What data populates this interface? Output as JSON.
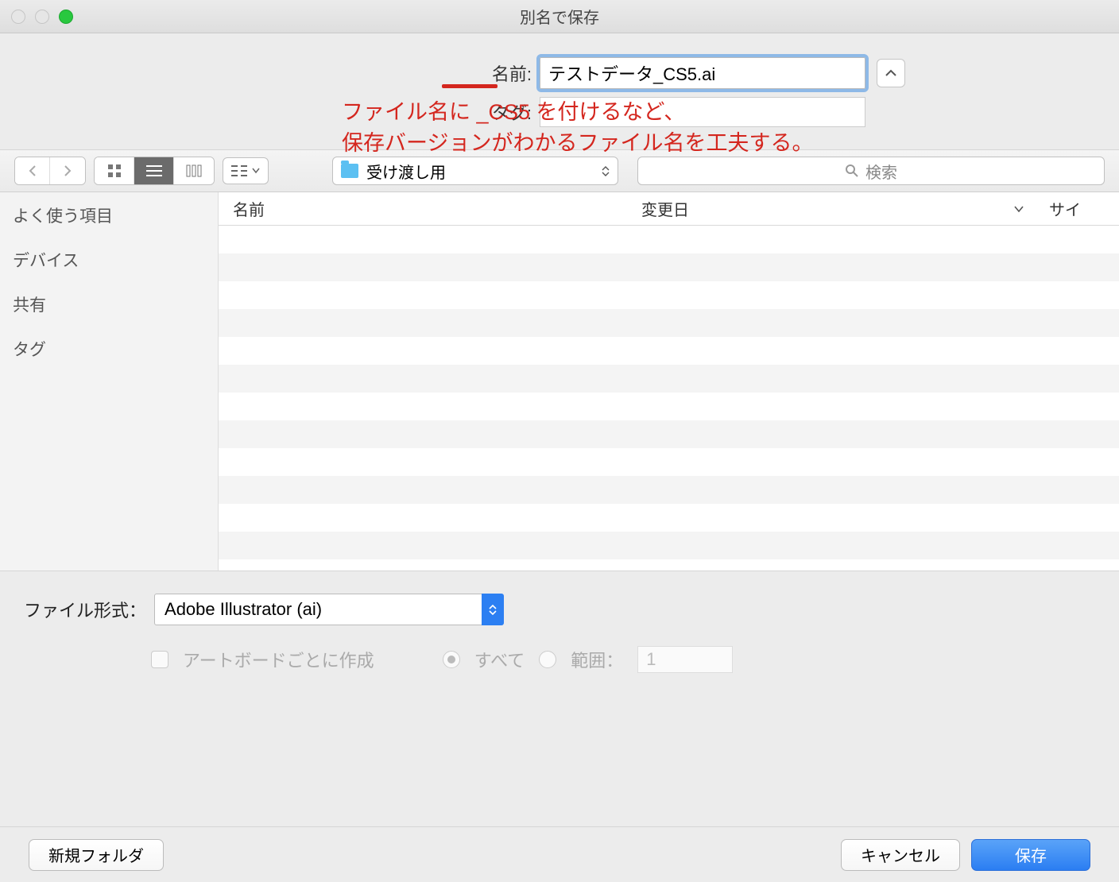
{
  "window": {
    "title": "別名で保存"
  },
  "name": {
    "label": "名前:",
    "value": "テストデータ_CS5.ai"
  },
  "tag": {
    "label": "タグ:"
  },
  "annotation": {
    "line1": "ファイル名に _CS5 を付けるなど、",
    "line2": "保存バージョンがわかるファイル名を工夫する。"
  },
  "folder": {
    "name": "受け渡し用"
  },
  "search": {
    "placeholder": "検索"
  },
  "sidebar": {
    "favorites": "よく使う項目",
    "devices": "デバイス",
    "shared": "共有",
    "tags": "タグ"
  },
  "columns": {
    "name": "名前",
    "modified": "変更日",
    "size": "サイ"
  },
  "format": {
    "label": "ファイル形式：",
    "value": "Adobe Illustrator (ai)"
  },
  "options": {
    "artboards": "アートボードごとに作成",
    "all": "すべて",
    "range": "範囲：",
    "range_value": "1"
  },
  "buttons": {
    "newfolder": "新規フォルダ",
    "cancel": "キャンセル",
    "save": "保存"
  }
}
